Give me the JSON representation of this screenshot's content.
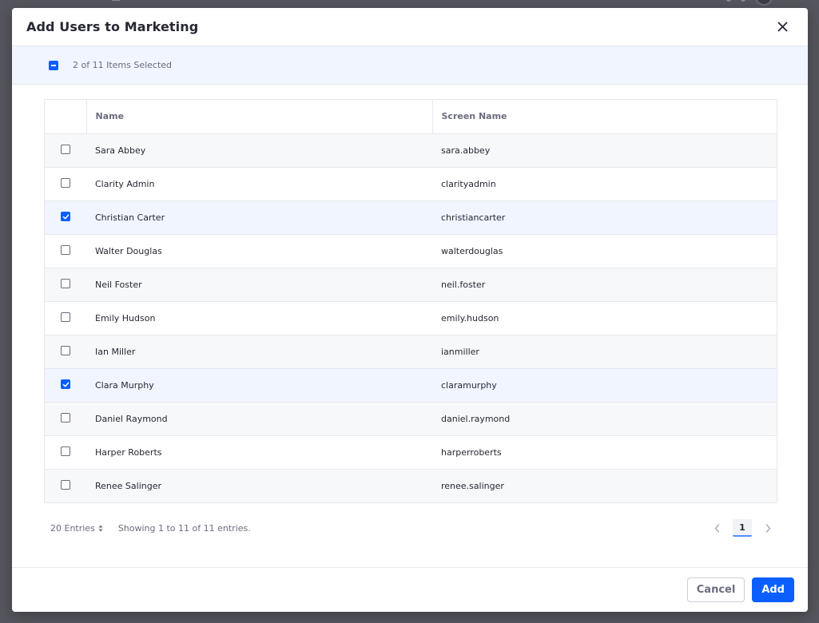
{
  "modal": {
    "title": "Add Users to Marketing",
    "close_icon": "close-icon"
  },
  "selection": {
    "text": "2 of 11 Items Selected",
    "state": "indeterminate"
  },
  "table": {
    "headers": {
      "name": "Name",
      "screen_name": "Screen Name"
    },
    "rows": [
      {
        "name": "Sara Abbey",
        "screen_name": "sara.abbey",
        "checked": false
      },
      {
        "name": "Clarity Admin",
        "screen_name": "clarityadmin",
        "checked": false
      },
      {
        "name": "Christian Carter",
        "screen_name": "christiancarter",
        "checked": true
      },
      {
        "name": "Walter Douglas",
        "screen_name": "walterdouglas",
        "checked": false
      },
      {
        "name": "Neil Foster",
        "screen_name": "neil.foster",
        "checked": false
      },
      {
        "name": "Emily Hudson",
        "screen_name": "emily.hudson",
        "checked": false
      },
      {
        "name": "Ian Miller",
        "screen_name": "ianmiller",
        "checked": false
      },
      {
        "name": "Clara Murphy",
        "screen_name": "claramurphy",
        "checked": true
      },
      {
        "name": "Daniel Raymond",
        "screen_name": "daniel.raymond",
        "checked": false
      },
      {
        "name": "Harper Roberts",
        "screen_name": "harperroberts",
        "checked": false
      },
      {
        "name": "Renee Salinger",
        "screen_name": "renee.salinger",
        "checked": false
      }
    ]
  },
  "pagination": {
    "entries_label": "20 Entries",
    "showing_text": "Showing 1 to 11 of 11 entries.",
    "current_page": "1"
  },
  "footer": {
    "cancel_label": "Cancel",
    "add_label": "Add"
  },
  "colors": {
    "primary": "#0b5fff",
    "selected_row_bg": "#f0f5ff",
    "backdrop": "#55565d"
  }
}
